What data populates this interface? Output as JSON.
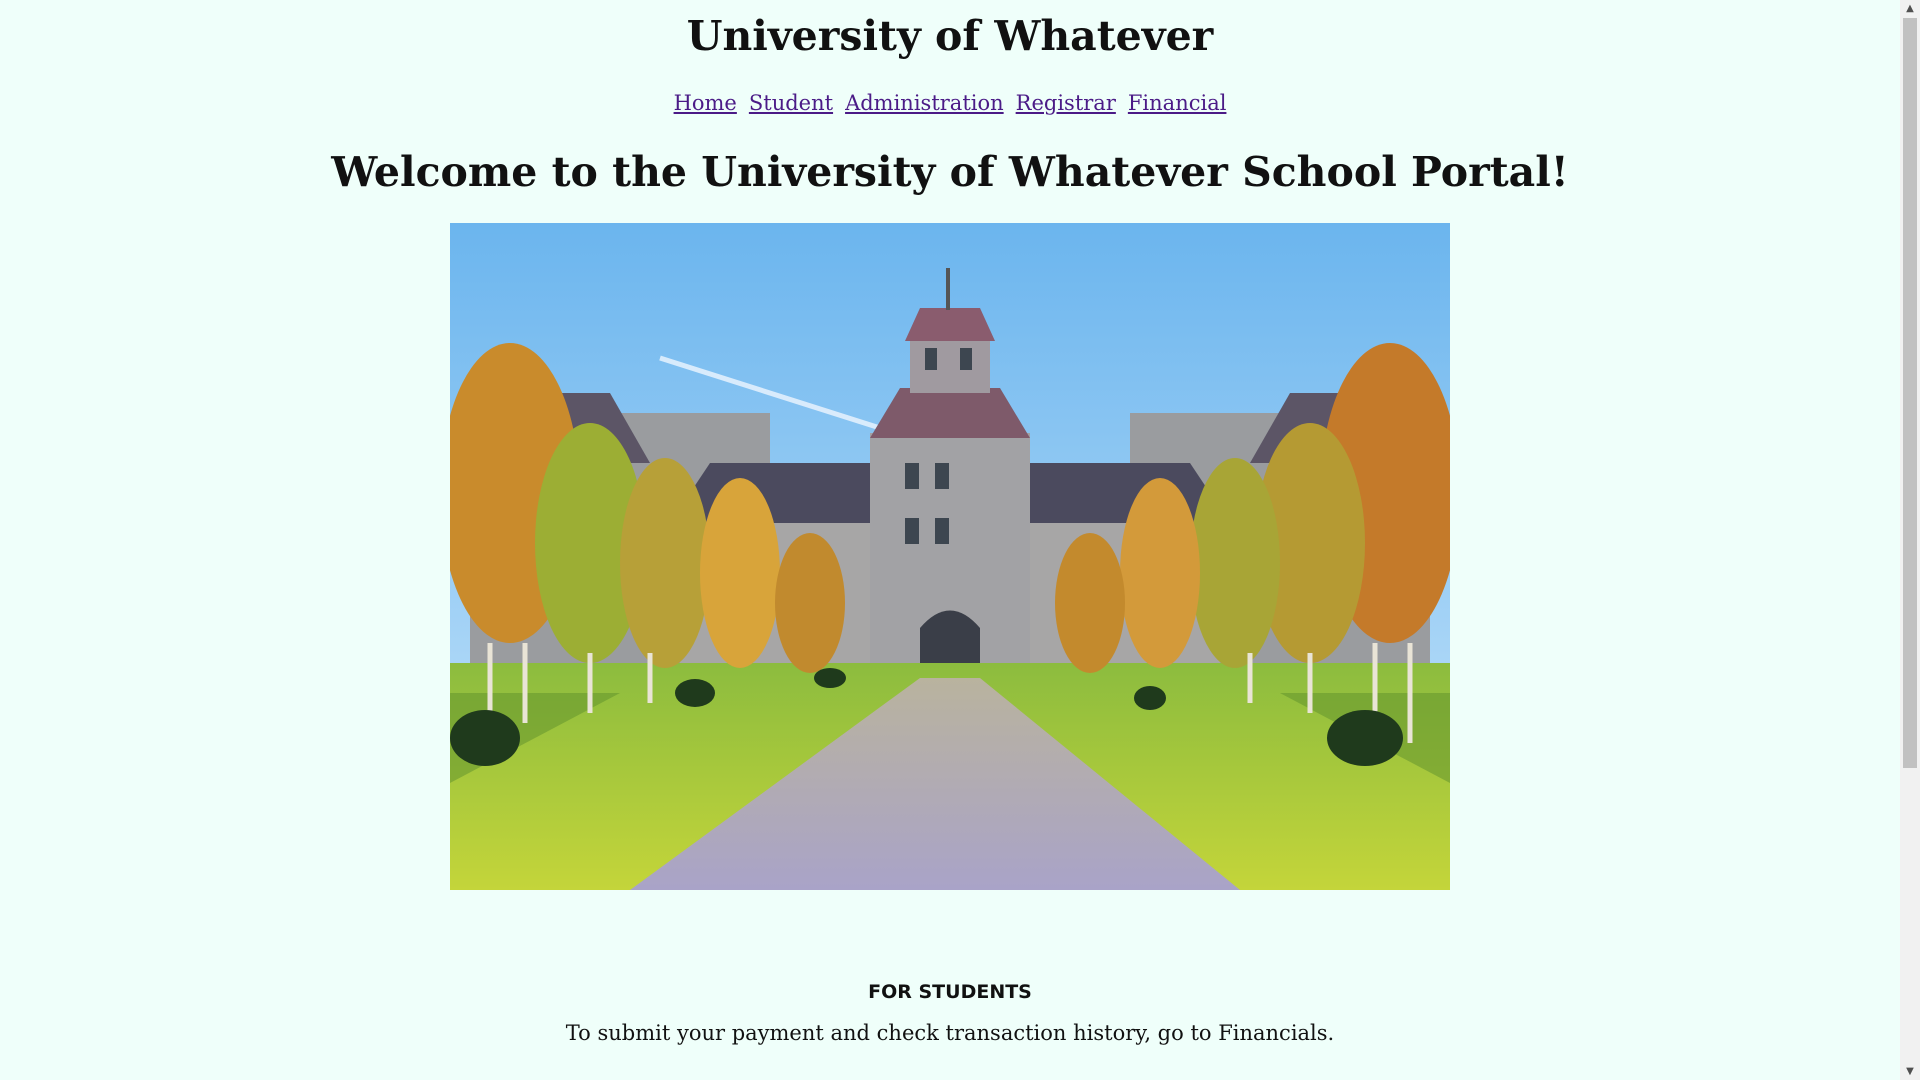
{
  "header": {
    "site_title": "University of Whatever"
  },
  "nav": {
    "items": [
      {
        "label": "Home"
      },
      {
        "label": "Student"
      },
      {
        "label": "Administration"
      },
      {
        "label": "Registrar"
      },
      {
        "label": "Financial"
      }
    ]
  },
  "main": {
    "welcome": "Welcome to the University of Whatever School Portal!",
    "section_heading": "FOR STUDENTS",
    "section_text": "To submit your payment and check transaction history, go to Financials."
  },
  "colors": {
    "background": "#effffa",
    "link": "#4b1b87"
  }
}
